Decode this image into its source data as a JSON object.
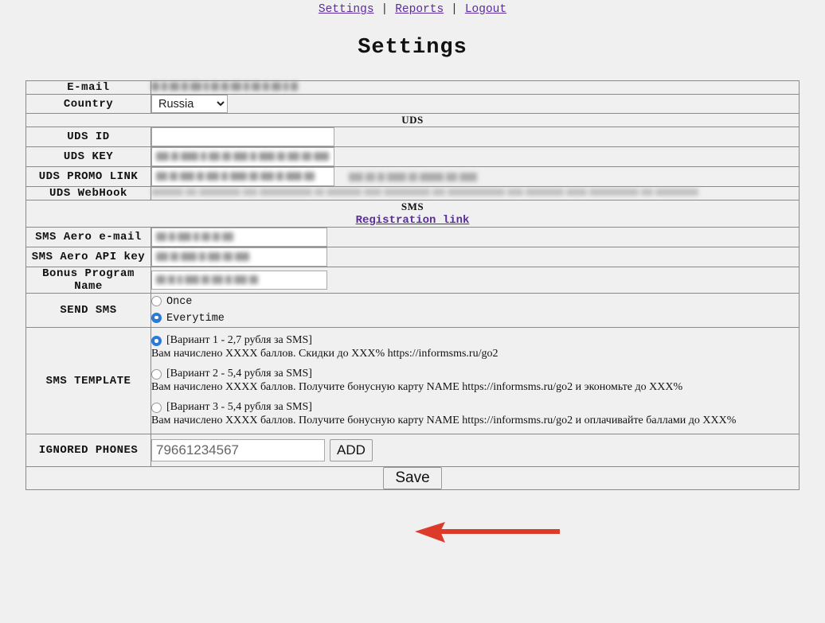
{
  "nav": {
    "items": [
      {
        "label": "Settings"
      },
      {
        "label": "Reports"
      },
      {
        "label": "Logout"
      }
    ],
    "separator": "|"
  },
  "page": {
    "title": "Settings"
  },
  "form": {
    "email": {
      "label": "E-mail",
      "value": "",
      "redacted": true
    },
    "country": {
      "label": "Country",
      "value": "Russia"
    },
    "uds_section": {
      "label": "UDS"
    },
    "uds_id": {
      "label": "UDS ID",
      "value": ""
    },
    "uds_key": {
      "label": "UDS KEY",
      "value": "",
      "redacted": true
    },
    "uds_promo_link": {
      "label": "UDS PROMO LINK",
      "value": "",
      "redacted": true
    },
    "uds_webhook": {
      "label": "UDS WebHook",
      "value": "",
      "redacted": true
    },
    "sms_section": {
      "label": "SMS",
      "link_label": "Registration link"
    },
    "sms_aero_email": {
      "label": "SMS Aero e-mail",
      "value": "",
      "redacted": true
    },
    "sms_aero_api_key": {
      "label": "SMS Aero API key",
      "value": "",
      "redacted": true
    },
    "bonus_program_name": {
      "label": "Bonus Program Name",
      "value": "",
      "redacted": true
    },
    "send_sms": {
      "label": "SEND SMS",
      "options": [
        {
          "label": "Once",
          "selected": false
        },
        {
          "label": "Everytime",
          "selected": true
        }
      ]
    },
    "sms_template": {
      "label": "SMS TEMPLATE",
      "options": [
        {
          "head": "[Вариант 1 - 2,7 рубля за SMS]",
          "body": "Вам начислено XXXX баллов. Скидки до XXX% https://informsms.ru/go2",
          "selected": true
        },
        {
          "head": "[Вариант 2 - 5,4 рубля за SMS]",
          "body": "Вам начислено XXXX баллов. Получите бонусную карту NAME https://informsms.ru/go2 и экономьте до XXX%",
          "selected": false
        },
        {
          "head": "[Вариант 3 - 5,4 рубля за SMS]",
          "body": "Вам начислено XXXX баллов. Получите бонусную карту NAME https://informsms.ru/go2 и оплачивайте баллами до XXX%",
          "selected": false
        }
      ]
    },
    "ignored_phones": {
      "label": "IGNORED PHONES",
      "placeholder": "79661234567",
      "value": "",
      "add_label": "ADD"
    },
    "save": {
      "label": "Save"
    }
  },
  "annotation": {
    "arrow_color": "#dd3b2a",
    "arrow_direction": "left",
    "points_at": "add-button"
  },
  "colors": {
    "background": "#f0f0f0",
    "link": "#5a2d9b",
    "border": "#8a8a8a",
    "radio_selected": "#2a7bd8",
    "arrow": "#dd3b2a"
  }
}
